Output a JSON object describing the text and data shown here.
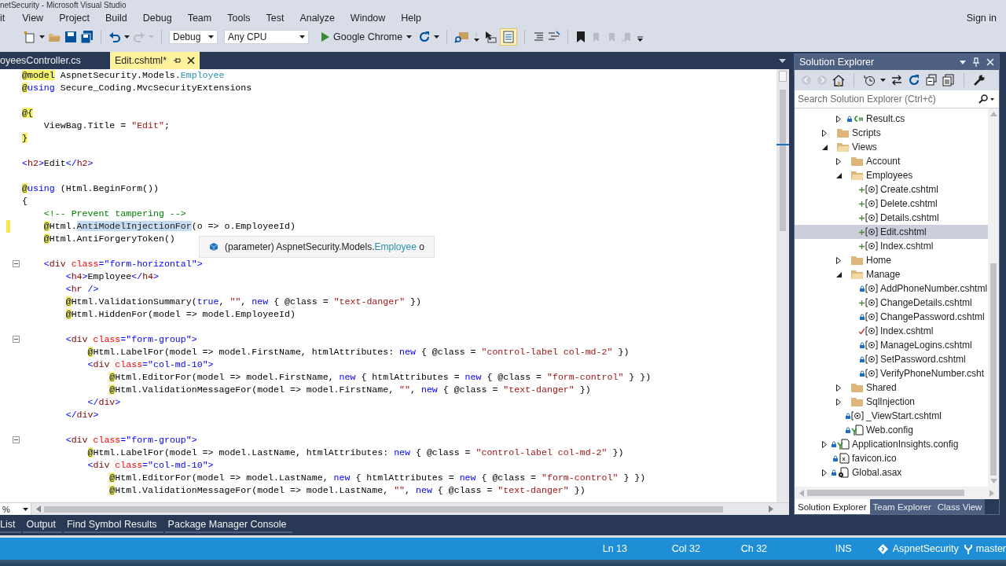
{
  "window": {
    "title": "netSecurity - Microsoft Visual Studio"
  },
  "menu": [
    "it",
    "View",
    "Project",
    "Build",
    "Debug",
    "Team",
    "Tools",
    "Test",
    "Analyze",
    "Window",
    "Help"
  ],
  "account": "Sign in",
  "toolbar": {
    "configuration": "Debug",
    "platform": "Any CPU",
    "start": "Google Chrome"
  },
  "editor_tabs": [
    {
      "label": "oyeesController.cs",
      "selected": false
    },
    {
      "label": "Edit.cshtml*",
      "selected": true
    }
  ],
  "code_lines": [
    {
      "tokens": [
        {
          "kind": "at",
          "text": "@model"
        },
        {
          "kind": "p",
          "text": " AspnetSecurity.Models."
        },
        {
          "kind": "type",
          "text": "Employee"
        }
      ],
      "fold": false,
      "changed": false
    },
    {
      "tokens": [
        {
          "kind": "at",
          "text": "@"
        },
        {
          "kind": "kw",
          "text": "using"
        },
        {
          "kind": "p",
          "text": " Secure_Coding.MvcSecurityExtensions"
        }
      ],
      "fold": false,
      "changed": false
    },
    {
      "fold": false,
      "changed": false
    },
    {
      "tokens": [
        {
          "kind": "at",
          "text": "@{"
        }
      ],
      "fold": false,
      "changed": false
    },
    {
      "tokens": [
        {
          "kind": "p",
          "text": "    ViewBag.Title = "
        },
        {
          "kind": "str",
          "text": "\"Edit\""
        },
        {
          "kind": "p",
          "text": ";"
        }
      ],
      "fold": false,
      "changed": false
    },
    {
      "tokens": [
        {
          "kind": "at",
          "text": "}"
        }
      ],
      "fold": false,
      "changed": false
    },
    {
      "fold": false,
      "changed": false
    },
    {
      "tokens": [
        {
          "kind": "tagp",
          "text": "<"
        },
        {
          "kind": "tag",
          "text": "h2"
        },
        {
          "kind": "tagp",
          "text": ">"
        },
        {
          "kind": "p",
          "text": "Edit"
        },
        {
          "kind": "tagp",
          "text": "</"
        },
        {
          "kind": "tag",
          "text": "h2"
        },
        {
          "kind": "tagp",
          "text": ">"
        }
      ],
      "fold": false,
      "changed": false
    },
    {
      "fold": false,
      "changed": false
    },
    {
      "tokens": [
        {
          "kind": "at",
          "text": "@"
        },
        {
          "kind": "kw",
          "text": "using"
        },
        {
          "kind": "p",
          "text": " (Html.BeginForm())"
        }
      ],
      "fold": false,
      "changed": false
    },
    {
      "tokens": [
        {
          "kind": "p",
          "text": "{"
        }
      ],
      "fold": false,
      "changed": false
    },
    {
      "tokens": [
        {
          "kind": "com",
          "text": "    <!-- Prevent tampering -->"
        }
      ],
      "fold": false,
      "changed": false
    },
    {
      "tokens": [
        {
          "kind": "at",
          "text": "    @"
        },
        {
          "kind": "p",
          "text": "Html."
        },
        {
          "kind": "hl",
          "text": "AntiModelInjectionFor"
        },
        {
          "kind": "p",
          "text": "(o => o.EmployeeId)"
        }
      ],
      "fold": false,
      "changed": true
    },
    {
      "tokens": [
        {
          "kind": "at",
          "text": "    @"
        },
        {
          "kind": "p",
          "text": "Html.AntiForgeryToken()"
        }
      ],
      "fold": false,
      "changed": false
    },
    {
      "fold": false,
      "changed": false
    },
    {
      "tokens": [
        {
          "kind": "tagp",
          "text": "    <"
        },
        {
          "kind": "tag",
          "text": "div"
        },
        {
          "kind": "attr",
          "text": " class"
        },
        {
          "kind": "tagp",
          "text": "="
        },
        {
          "kind": "val",
          "text": "\"form-horizontal\""
        },
        {
          "kind": "tagp",
          "text": ">"
        }
      ],
      "fold": true,
      "changed": false
    },
    {
      "tokens": [
        {
          "kind": "tagp",
          "text": "        <"
        },
        {
          "kind": "tag",
          "text": "h4"
        },
        {
          "kind": "tagp",
          "text": ">"
        },
        {
          "kind": "p",
          "text": "Employee"
        },
        {
          "kind": "tagp",
          "text": "</"
        },
        {
          "kind": "tag",
          "text": "h4"
        },
        {
          "kind": "tagp",
          "text": ">"
        }
      ],
      "fold": false,
      "changed": false
    },
    {
      "tokens": [
        {
          "kind": "tagp",
          "text": "        <"
        },
        {
          "kind": "tag",
          "text": "hr"
        },
        {
          "kind": "tagp",
          "text": " />"
        }
      ],
      "fold": false,
      "changed": false
    },
    {
      "tokens": [
        {
          "kind": "at",
          "text": "        @"
        },
        {
          "kind": "p",
          "text": "Html.ValidationSummary("
        },
        {
          "kind": "kw",
          "text": "true"
        },
        {
          "kind": "p",
          "text": ", "
        },
        {
          "kind": "str",
          "text": "\"\""
        },
        {
          "kind": "p",
          "text": ", "
        },
        {
          "kind": "kw",
          "text": "new"
        },
        {
          "kind": "p",
          "text": " { @class = "
        },
        {
          "kind": "str",
          "text": "\"text-danger\""
        },
        {
          "kind": "p",
          "text": " })"
        }
      ],
      "fold": false,
      "changed": false
    },
    {
      "tokens": [
        {
          "kind": "at",
          "text": "        @"
        },
        {
          "kind": "p",
          "text": "Html.HiddenFor(model => model.EmployeeId)"
        }
      ],
      "fold": false,
      "changed": false
    },
    {
      "fold": false,
      "changed": false
    },
    {
      "tokens": [
        {
          "kind": "tagp",
          "text": "        <"
        },
        {
          "kind": "tag",
          "text": "div"
        },
        {
          "kind": "attr",
          "text": " class"
        },
        {
          "kind": "tagp",
          "text": "="
        },
        {
          "kind": "val",
          "text": "\"form-group\""
        },
        {
          "kind": "tagp",
          "text": ">"
        }
      ],
      "fold": true,
      "changed": false
    },
    {
      "tokens": [
        {
          "kind": "at",
          "text": "            @"
        },
        {
          "kind": "p",
          "text": "Html.LabelFor(model => model.FirstName, htmlAttributes: "
        },
        {
          "kind": "kw",
          "text": "new"
        },
        {
          "kind": "p",
          "text": " { @class = "
        },
        {
          "kind": "str",
          "text": "\"control-label col-md-2\""
        },
        {
          "kind": "p",
          "text": " })"
        }
      ],
      "fold": false,
      "changed": false
    },
    {
      "tokens": [
        {
          "kind": "tagp",
          "text": "            <"
        },
        {
          "kind": "tag",
          "text": "div"
        },
        {
          "kind": "attr",
          "text": " class"
        },
        {
          "kind": "tagp",
          "text": "="
        },
        {
          "kind": "val",
          "text": "\"col-md-10\""
        },
        {
          "kind": "tagp",
          "text": ">"
        }
      ],
      "fold": false,
      "changed": false
    },
    {
      "tokens": [
        {
          "kind": "at",
          "text": "                @"
        },
        {
          "kind": "p",
          "text": "Html.EditorFor(model => model.FirstName, "
        },
        {
          "kind": "kw",
          "text": "new"
        },
        {
          "kind": "p",
          "text": " { htmlAttributes = "
        },
        {
          "kind": "kw",
          "text": "new"
        },
        {
          "kind": "p",
          "text": " { @class = "
        },
        {
          "kind": "str",
          "text": "\"form-control\""
        },
        {
          "kind": "p",
          "text": " } })"
        }
      ],
      "fold": false,
      "changed": false
    },
    {
      "tokens": [
        {
          "kind": "at",
          "text": "                @"
        },
        {
          "kind": "p",
          "text": "Html.ValidationMessageFor(model => model.FirstName, "
        },
        {
          "kind": "str",
          "text": "\"\""
        },
        {
          "kind": "p",
          "text": ", "
        },
        {
          "kind": "kw",
          "text": "new"
        },
        {
          "kind": "p",
          "text": " { @class = "
        },
        {
          "kind": "str",
          "text": "\"text-danger\""
        },
        {
          "kind": "p",
          "text": " })"
        }
      ],
      "fold": false,
      "changed": false
    },
    {
      "tokens": [
        {
          "kind": "tagp",
          "text": "            </"
        },
        {
          "kind": "tag",
          "text": "div"
        },
        {
          "kind": "tagp",
          "text": ">"
        }
      ],
      "fold": false,
      "changed": false
    },
    {
      "tokens": [
        {
          "kind": "tagp",
          "text": "        </"
        },
        {
          "kind": "tag",
          "text": "div"
        },
        {
          "kind": "tagp",
          "text": ">"
        }
      ],
      "fold": false,
      "changed": false
    },
    {
      "fold": false,
      "changed": false
    },
    {
      "tokens": [
        {
          "kind": "tagp",
          "text": "        <"
        },
        {
          "kind": "tag",
          "text": "div"
        },
        {
          "kind": "attr",
          "text": " class"
        },
        {
          "kind": "tagp",
          "text": "="
        },
        {
          "kind": "val",
          "text": "\"form-group\""
        },
        {
          "kind": "tagp",
          "text": ">"
        }
      ],
      "fold": true,
      "changed": false
    },
    {
      "tokens": [
        {
          "kind": "at",
          "text": "            @"
        },
        {
          "kind": "p",
          "text": "Html.LabelFor(model => model.LastName, htmlAttributes: "
        },
        {
          "kind": "kw",
          "text": "new"
        },
        {
          "kind": "p",
          "text": " { @class = "
        },
        {
          "kind": "str",
          "text": "\"control-label col-md-2\""
        },
        {
          "kind": "p",
          "text": " })"
        }
      ],
      "fold": false,
      "changed": false
    },
    {
      "tokens": [
        {
          "kind": "tagp",
          "text": "            <"
        },
        {
          "kind": "tag",
          "text": "div"
        },
        {
          "kind": "attr",
          "text": " class"
        },
        {
          "kind": "tagp",
          "text": "="
        },
        {
          "kind": "val",
          "text": "\"col-md-10\""
        },
        {
          "kind": "tagp",
          "text": ">"
        }
      ],
      "fold": false,
      "changed": false
    },
    {
      "tokens": [
        {
          "kind": "at",
          "text": "                @"
        },
        {
          "kind": "p",
          "text": "Html.EditorFor(model => model.LastName, "
        },
        {
          "kind": "kw",
          "text": "new"
        },
        {
          "kind": "p",
          "text": " { htmlAttributes = "
        },
        {
          "kind": "kw",
          "text": "new"
        },
        {
          "kind": "p",
          "text": " { @class = "
        },
        {
          "kind": "str",
          "text": "\"form-control\""
        },
        {
          "kind": "p",
          "text": " } })"
        }
      ],
      "fold": false,
      "changed": false
    },
    {
      "tokens": [
        {
          "kind": "at",
          "text": "                @"
        },
        {
          "kind": "p",
          "text": "Html.ValidationMessageFor(model => model.LastName, "
        },
        {
          "kind": "str",
          "text": "\"\""
        },
        {
          "kind": "p",
          "text": ", "
        },
        {
          "kind": "kw",
          "text": "new"
        },
        {
          "kind": "p",
          "text": " { @class = "
        },
        {
          "kind": "str",
          "text": "\"text-danger\""
        },
        {
          "kind": "p",
          "text": " })"
        }
      ],
      "fold": false,
      "changed": false
    }
  ],
  "tooltip": {
    "tokens": [
      {
        "kind": "p",
        "text": "(parameter) AspnetSecurity.Models."
      },
      {
        "kind": "type",
        "text": "Employee"
      },
      {
        "kind": "p",
        "text": " o"
      }
    ]
  },
  "zoom_box": "%",
  "solution_explorer": {
    "title": "Solution Explorer",
    "search": {
      "placeholder": "Search Solution Explorer (Ctrl+č)"
    },
    "tree": [
      {
        "children": [
          {
            "label": "Result.cs",
            "kind": "cs-locked",
            "expanded": false,
            "selected": false
          }
        ]
      },
      {
        "label": "Scripts",
        "kind": "folder",
        "expanded": false,
        "selected": false
      },
      {
        "label": "Views",
        "kind": "folder",
        "expanded": true,
        "selected": false,
        "children": [
          {
            "label": "Account",
            "kind": "folder",
            "expanded": false,
            "selected": false
          },
          {
            "label": "Employees",
            "kind": "folder",
            "expanded": true,
            "selected": false,
            "children": [
              {
                "label": "Create.cshtml",
                "kind": "razor-added",
                "selected": false
              },
              {
                "label": "Delete.cshtml",
                "kind": "razor-added",
                "selected": false
              },
              {
                "label": "Details.cshtml",
                "kind": "razor-added",
                "selected": false
              },
              {
                "label": "Edit.cshtml",
                "kind": "razor-added",
                "selected": true
              },
              {
                "label": "Index.cshtml",
                "kind": "razor-added",
                "selected": false
              }
            ]
          },
          {
            "label": "Home",
            "kind": "folder",
            "expanded": false,
            "selected": false
          },
          {
            "label": "Manage",
            "kind": "folder",
            "expanded": true,
            "selected": false,
            "children": [
              {
                "label": "AddPhoneNumber.cshtml",
                "kind": "razor-locked",
                "selected": false
              },
              {
                "label": "ChangeDetails.cshtml",
                "kind": "razor-added",
                "selected": false
              },
              {
                "label": "ChangePassword.cshtml",
                "kind": "razor-locked",
                "selected": false
              },
              {
                "label": "Index.cshtml",
                "kind": "razor-modified",
                "selected": false
              },
              {
                "label": "ManageLogins.cshtml",
                "kind": "razor-locked",
                "selected": false
              },
              {
                "label": "SetPassword.cshtml",
                "kind": "razor-locked",
                "selected": false
              },
              {
                "label": "VerifyPhoneNumber.csht",
                "kind": "razor-locked",
                "selected": false
              }
            ]
          },
          {
            "label": "Shared",
            "kind": "folder",
            "expanded": false,
            "selected": false
          },
          {
            "label": "SqlInjection",
            "kind": "folder",
            "expanded": false,
            "selected": false
          },
          {
            "label": "_ViewStart.cshtml",
            "kind": "razor-locked",
            "selected": false
          },
          {
            "label": "Web.config",
            "kind": "config-locked",
            "selected": false
          }
        ]
      },
      {
        "label": "ApplicationInsights.config",
        "kind": "config-locked",
        "expanded": false,
        "selected": false
      },
      {
        "label": "favicon.ico",
        "kind": "ico-locked",
        "selected": false
      },
      {
        "label": "Global.asax",
        "kind": "asax-locked",
        "expanded": false,
        "selected": false
      }
    ],
    "tabs": [
      {
        "label": "Solution Explorer",
        "selected": true
      },
      {
        "label": "Team Explorer",
        "selected": false
      },
      {
        "label": "Class View",
        "selected": false
      }
    ]
  },
  "tool_tabs": [
    {
      "label": "List",
      "selected": false
    },
    {
      "label": "Output",
      "selected": false
    },
    {
      "label": "Find Symbol Results",
      "selected": false
    },
    {
      "label": "Package Manager Console",
      "selected": false
    }
  ],
  "status_bar": {
    "line": "Ln 13",
    "column": "Col 32",
    "char": "Ch 32",
    "mode": "INS",
    "project": "AspnetSecurity",
    "branch": "master"
  }
}
